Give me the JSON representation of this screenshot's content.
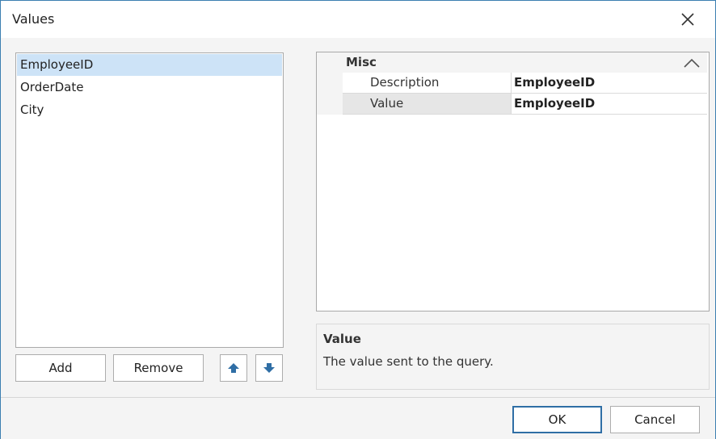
{
  "window": {
    "title": "Values"
  },
  "list": {
    "items": [
      {
        "label": "EmployeeID",
        "selected": true
      },
      {
        "label": "OrderDate",
        "selected": false
      },
      {
        "label": "City",
        "selected": false
      }
    ]
  },
  "buttons": {
    "add": "Add",
    "remove": "Remove",
    "move_up_icon": "arrow-up-icon",
    "move_down_icon": "arrow-down-icon",
    "ok": "OK",
    "cancel": "Cancel"
  },
  "property_grid": {
    "category": "Misc",
    "rows": [
      {
        "name": "Description",
        "value": "EmployeeID"
      },
      {
        "name": "Value",
        "value": "EmployeeID"
      }
    ]
  },
  "description_panel": {
    "title": "Value",
    "text": "The value sent to the query."
  },
  "colors": {
    "accent": "#2f6ea5",
    "selection": "#cde3f7",
    "window_border": "#3c7fb1"
  }
}
